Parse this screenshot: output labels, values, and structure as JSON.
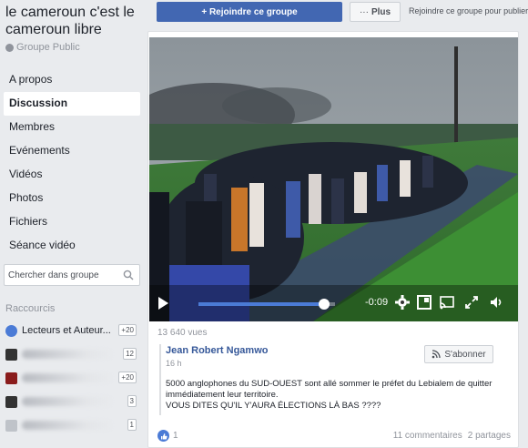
{
  "group": {
    "name": "le cameroun c'est le cameroun libre",
    "type": "Groupe Public"
  },
  "nav": {
    "items": [
      {
        "label": "A propos",
        "active": false
      },
      {
        "label": "Discussion",
        "active": true
      },
      {
        "label": "Membres",
        "active": false
      },
      {
        "label": "Evénements",
        "active": false
      },
      {
        "label": "Vidéos",
        "active": false
      },
      {
        "label": "Photos",
        "active": false
      },
      {
        "label": "Fichiers",
        "active": false
      },
      {
        "label": "Séance vidéo",
        "active": false
      }
    ]
  },
  "search": {
    "placeholder": "Chercher dans groupe"
  },
  "shortcuts": {
    "title": "Raccourcis",
    "items": [
      {
        "label": "Lecteurs et Auteur...",
        "badge": "+20",
        "icon": "group-icon",
        "blurred": false
      },
      {
        "label": "",
        "badge": "12",
        "icon": "page-icon",
        "blurred": true
      },
      {
        "label": "",
        "badge": "+20",
        "icon": "page-icon",
        "blurred": true
      },
      {
        "label": "",
        "badge": "3",
        "icon": "page-icon",
        "blurred": true
      },
      {
        "label": "",
        "badge": "1",
        "icon": "page-icon",
        "blurred": true
      }
    ]
  },
  "topbar": {
    "join_label": "+ Rejoindre ce groupe",
    "more_label": "Plus",
    "more_prefix": "···",
    "link_text": "Rejoindre ce groupe pour publier"
  },
  "video": {
    "time": "-0:09",
    "progress": 0.92
  },
  "post": {
    "views": "13 640 vues",
    "author": "Jean Robert Ngamwo",
    "time": "16 h",
    "follow_label": "S'abonner",
    "text_line1": "5000 anglophones du SUD-OUEST sont allé sommer le préfet du Lebialem de quitter immédiatement leur territoire.",
    "text_line2": "VOUS DITES QU'IL Y'AURA ÉLECTIONS LÀ BAS ????",
    "likes": "1",
    "comments": "11 commentaires",
    "shares": "2 partages"
  },
  "colors": {
    "brand_blue": "#4267b2",
    "link_blue": "#365899",
    "background": "#e9ebee"
  }
}
